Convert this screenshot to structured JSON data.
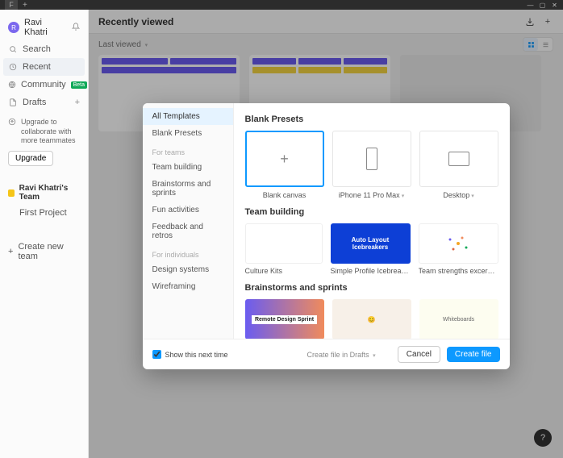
{
  "titlebar": {
    "win_min": "—",
    "win_max": "▢",
    "win_close": "✕",
    "tab_icon": "F",
    "plus": "+"
  },
  "sidebar": {
    "user": {
      "initials": "R",
      "name": "Ravi Khatri"
    },
    "nav": {
      "search": "Search",
      "recent": "Recent",
      "community": "Community",
      "community_badge": "Beta",
      "drafts": "Drafts"
    },
    "upgrade": {
      "text": "Upgrade to collaborate with more teammates",
      "button": "Upgrade"
    },
    "team_name": "Ravi Khatri's Team",
    "project": "First Project",
    "create_team": "Create new team"
  },
  "main": {
    "title": "Recently viewed",
    "sort": "Last viewed"
  },
  "modal": {
    "sidebar": {
      "all": "All Templates",
      "blank": "Blank Presets",
      "head_teams": "For teams",
      "cats_teams": [
        "Team building",
        "Brainstorms and sprints",
        "Fun activities",
        "Feedback and retros"
      ],
      "head_indiv": "For individuals",
      "cats_indiv": [
        "Design systems",
        "Wireframing"
      ]
    },
    "sections": {
      "blank_title": "Blank Presets",
      "blank_items": [
        "Blank canvas",
        "iPhone 11 Pro Max",
        "Desktop"
      ],
      "team_title": "Team building",
      "team_items": [
        "Culture Kits",
        "Simple Profile Icebreaker A...",
        "Team strengths excercise"
      ],
      "brain_title": "Brainstorms and sprints",
      "auto_layout": "Auto Layout Icebreakers",
      "remote_sprint": "Remote Design Sprint",
      "whiteboards": "Whiteboards"
    },
    "footer": {
      "show_next": "Show this next time",
      "location": "Create file in Drafts",
      "cancel": "Cancel",
      "create": "Create file"
    }
  }
}
